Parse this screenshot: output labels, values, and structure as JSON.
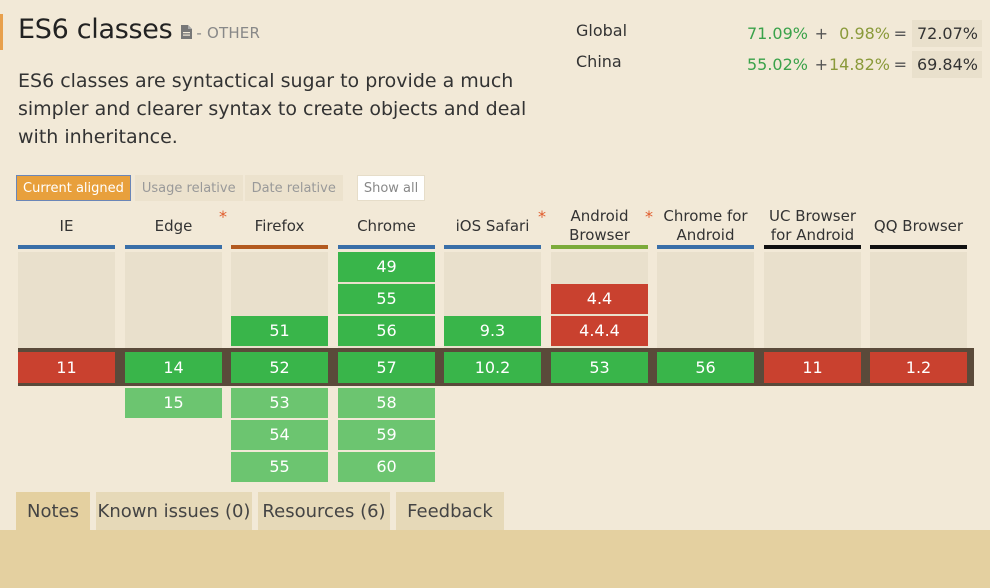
{
  "feature": {
    "title": "ES6 classes",
    "category": "- OTHER",
    "description": "ES6 classes are syntactical sugar to provide a much simpler and clearer syntax to create objects and deal with inheritance."
  },
  "usage": [
    {
      "label": "Global",
      "supported": "71.09%",
      "plus": "+",
      "partial": "0.98%",
      "equals": "=",
      "total": "72.07%"
    },
    {
      "label": "China",
      "supported": "55.02%",
      "plus": "+",
      "partial": "14.82%",
      "equals": "=",
      "total": "69.84%"
    }
  ],
  "view_options": {
    "current_aligned": "Current aligned",
    "usage_relative": "Usage relative",
    "date_relative": "Date relative",
    "show_all": "Show all"
  },
  "colors": {
    "supported": "#39b54a",
    "unsupported": "#c9412f",
    "future": "#6cc570",
    "accent": "#e8a03c"
  },
  "browsers": [
    {
      "line1": "IE",
      "line2": "",
      "asterisk": "",
      "underline": "#3a6fa8",
      "past": [],
      "current": {
        "v": "11",
        "s": "n"
      },
      "future": []
    },
    {
      "line1": "Edge",
      "line2": "",
      "asterisk": "*",
      "underline": "#3a6fa8",
      "past": [],
      "current": {
        "v": "14",
        "s": "y"
      },
      "future": [
        {
          "v": "15",
          "s": "f"
        }
      ]
    },
    {
      "line1": "Firefox",
      "line2": "",
      "asterisk": "",
      "underline": "#b35a1f",
      "past": [
        {
          "v": "51",
          "s": "y"
        }
      ],
      "current": {
        "v": "52",
        "s": "y"
      },
      "future": [
        {
          "v": "53",
          "s": "f"
        },
        {
          "v": "54",
          "s": "f"
        },
        {
          "v": "55",
          "s": "f"
        }
      ]
    },
    {
      "line1": "Chrome",
      "line2": "",
      "asterisk": "",
      "underline": "#3a6fa8",
      "past": [
        {
          "v": "49",
          "s": "y"
        },
        {
          "v": "55",
          "s": "y"
        },
        {
          "v": "56",
          "s": "y"
        }
      ],
      "current": {
        "v": "57",
        "s": "y"
      },
      "future": [
        {
          "v": "58",
          "s": "f"
        },
        {
          "v": "59",
          "s": "f"
        },
        {
          "v": "60",
          "s": "f"
        }
      ]
    },
    {
      "line1": "iOS Safari",
      "line2": "",
      "asterisk": "*",
      "underline": "#3a6fa8",
      "past": [
        {
          "v": "9.3",
          "s": "y"
        }
      ],
      "current": {
        "v": "10.2",
        "s": "y"
      },
      "future": []
    },
    {
      "line1": "Android",
      "line2": "Browser",
      "asterisk": "*",
      "underline": "#7cab3a",
      "past": [
        {
          "v": "4.4",
          "s": "n"
        },
        {
          "v": "4.4.4",
          "s": "n"
        }
      ],
      "current": {
        "v": "53",
        "s": "y"
      },
      "future": []
    },
    {
      "line1": "Chrome for",
      "line2": "Android",
      "asterisk": "",
      "underline": "#3a6fa8",
      "past": [],
      "current": {
        "v": "56",
        "s": "y"
      },
      "future": []
    },
    {
      "line1": "UC Browser",
      "line2": "for Android",
      "asterisk": "",
      "underline": "#111111",
      "past": [],
      "current": {
        "v": "11",
        "s": "n"
      },
      "future": []
    },
    {
      "line1": "QQ Browser",
      "line2": "",
      "asterisk": "",
      "underline": "#111111",
      "past": [],
      "current": {
        "v": "1.2",
        "s": "n"
      },
      "future": []
    }
  ],
  "tabs": [
    {
      "label": "Notes",
      "active": true
    },
    {
      "label": "Known issues (0)",
      "active": false
    },
    {
      "label": "Resources (6)",
      "active": false
    },
    {
      "label": "Feedback",
      "active": false
    }
  ]
}
